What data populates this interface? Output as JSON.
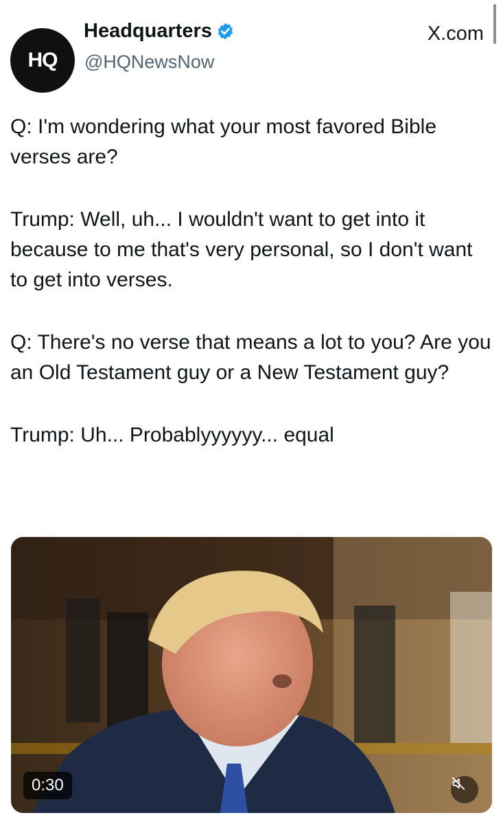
{
  "header": {
    "display_name": "Headquarters",
    "handle": "@HQNewsNow",
    "avatar_text": "HQ",
    "source": "X.com",
    "verified_color": "#1d9bf0"
  },
  "tweet": {
    "paragraphs": [
      "Q: I'm wondering what your most favored Bible verses are?",
      "Trump: Well, uh... I wouldn't want to get into it because to me that's very personal, so I don't want to get into verses.",
      "Q: There's no verse that means a lot to you? Are you an Old Testament guy or a New Testament guy?",
      "Trump: Uh... Probablyyyyyy... equal"
    ]
  },
  "media": {
    "type": "video",
    "duration": "0:30",
    "mute_icon": "speaker-muted-icon"
  }
}
